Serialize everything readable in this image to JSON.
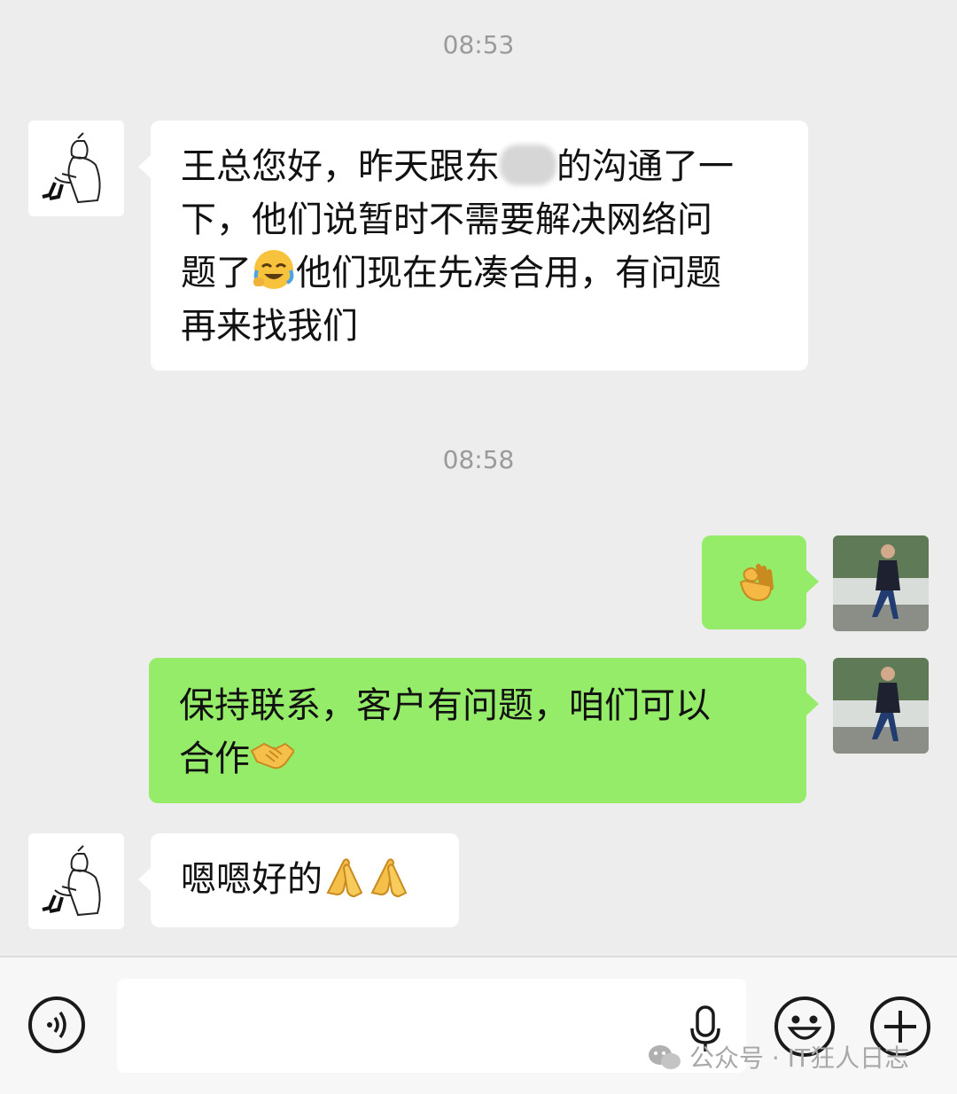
{
  "chat": {
    "timestamps": [
      "08:53",
      "08:58"
    ],
    "messages": [
      {
        "sender": "contact",
        "lines": [
          "王总您好，昨天跟东",
          "的沟通了一",
          "下，他们说暂时不需要解决网络问",
          "题了",
          "他们现在先凑合用，有问题",
          "再来找我们"
        ],
        "emojis": [
          "face-with-tears-emoji"
        ]
      },
      {
        "sender": "me",
        "lines": [],
        "emojis": [
          "ok-hand-emoji"
        ]
      },
      {
        "sender": "me",
        "lines": [
          "保持联系，客户有问题，咱们可以",
          "合作"
        ],
        "emojis": [
          "handshake-emoji"
        ]
      },
      {
        "sender": "contact",
        "lines": [
          "嗯嗯好的"
        ],
        "emojis": [
          "pray-emoji",
          "pray-emoji"
        ]
      }
    ]
  },
  "input_bar": {
    "voice_icon": "voice-mode-icon",
    "mic_icon": "microphone-icon",
    "emoji_icon": "smiley-icon",
    "plus_icon": "plus-icon",
    "input_value": ""
  },
  "watermark": {
    "text": "公众号 · IT狂人日志"
  },
  "colors": {
    "background": "#ededed",
    "incoming_bubble": "#ffffff",
    "outgoing_bubble": "#95ec69",
    "timestamp": "#9a9a9a"
  }
}
